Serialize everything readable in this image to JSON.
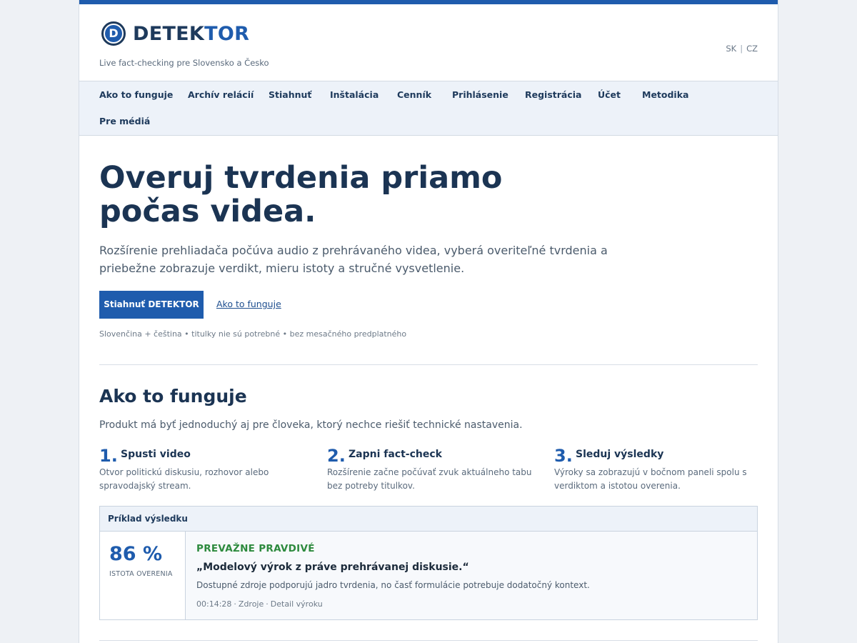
{
  "brand": {
    "logo_letter": "D",
    "name_part1": "DETEK",
    "name_part2": "TOR",
    "tagline": "Live fact-checking pre Slovensko a Česko"
  },
  "languages": [
    "SK",
    "CZ"
  ],
  "nav": {
    "items": [
      "Ako to funguje",
      "Archív relácií",
      "Stiahnuť",
      "Inštalácia",
      "Cenník",
      "Prihlásenie",
      "Registrácia",
      "Účet",
      "Metodika",
      "Pre médiá"
    ]
  },
  "hero": {
    "title": "Overuj tvrdenia priamo počas videa.",
    "description": "Rozšírenie prehliadača počúva audio z prehrávaného videa, vyberá overiteľné tvrdenia a priebežne zobrazuje verdikt, mieru istoty a stručné vysvetlenie.",
    "cta_label": "Stiahnuť DETEKTOR",
    "secondary_link": "Ako to funguje",
    "note": "Slovenčina + čeština • titulky nie sú potrebné • bez mesačného predplatného"
  },
  "how_it_works": {
    "title": "Ako to funguje",
    "description": "Produkt má byť jednoduchý aj pre človeka, ktorý nechce riešiť technické nastavenia.",
    "steps": [
      {
        "number": "1.",
        "title": "Spusti video",
        "description": "Otvor politickú diskusiu, rozhovor alebo spravodajský stream."
      },
      {
        "number": "2.",
        "title": "Zapni fact-check",
        "description": "Rozšírenie začne počúvať zvuk aktuálneho tabu bez potreby titulkov."
      },
      {
        "number": "3.",
        "title": "Sleduj výsledky",
        "description": "Výroky sa zobrazujú v bočnom paneli spolu s verdiktom a istotou overenia."
      }
    ]
  },
  "example": {
    "header": "Príklad výsledku",
    "score": "86 %",
    "score_label": "ISTOTA OVERENIA",
    "verdict": "PREVAŽNE PRAVDIVÉ",
    "quote": "„Modelový výrok z práve prehrávanej diskusie.“",
    "explanation": "Dostupné zdroje podporujú jadro tvrdenia, no časť formulácie potrebuje dodatočný kontext.",
    "timestamp": "00:14:28",
    "sources_link": "Zdroje",
    "detail_link": "Detail výroku"
  },
  "colors": {
    "accent": "#1f5cad",
    "heading": "#1b3453",
    "verdict_true": "#2d8a3e"
  }
}
